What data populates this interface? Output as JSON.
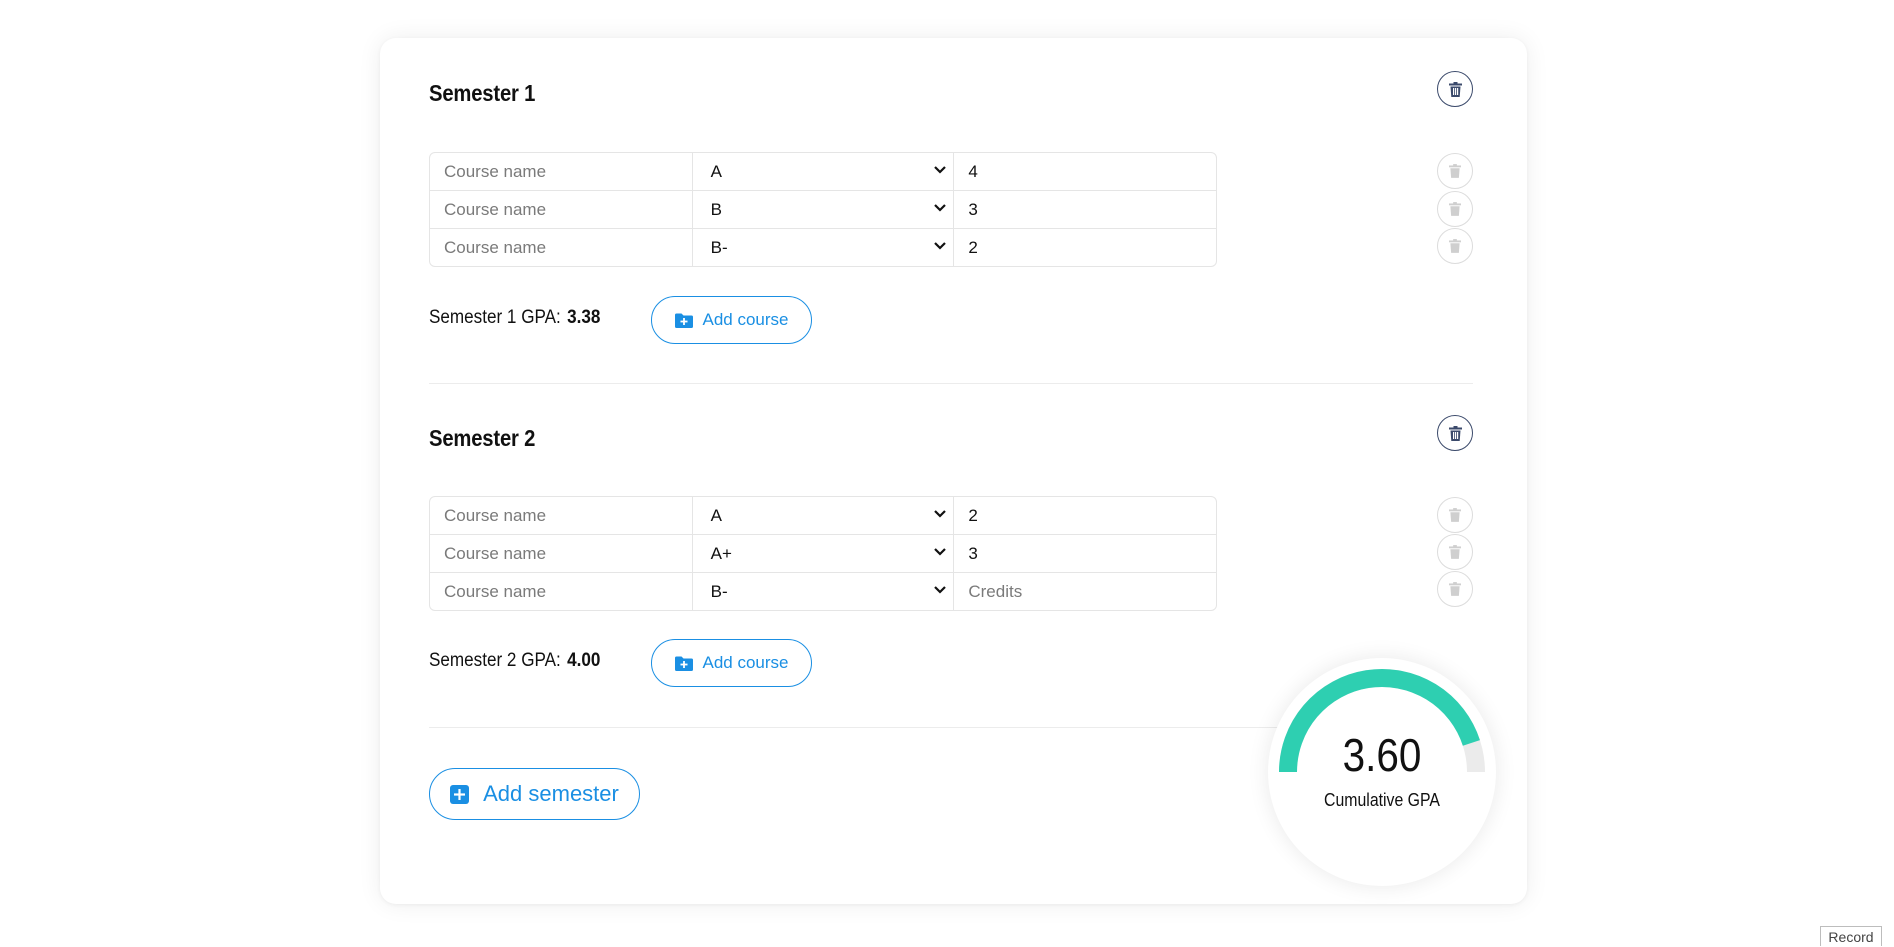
{
  "semesters": [
    {
      "title": "Semester 1",
      "gpa_label": "Semester 1 GPA:",
      "gpa_value": "3.38",
      "add_course_label": "Add course",
      "courses": [
        {
          "name": "",
          "grade": "A",
          "credits": "4"
        },
        {
          "name": "",
          "grade": "B",
          "credits": "3"
        },
        {
          "name": "",
          "grade": "B-",
          "credits": "2"
        }
      ]
    },
    {
      "title": "Semester 2",
      "gpa_label": "Semester 2 GPA:",
      "gpa_value": "4.00",
      "add_course_label": "Add course",
      "courses": [
        {
          "name": "",
          "grade": "A",
          "credits": "2"
        },
        {
          "name": "",
          "grade": "A+",
          "credits": "3"
        },
        {
          "name": "",
          "grade": "B-",
          "credits": ""
        }
      ]
    }
  ],
  "placeholders": {
    "course_name": "Course name",
    "credits": "Credits"
  },
  "add_semester_label": "Add semester",
  "cumulative": {
    "value": "3.60",
    "label": "Cumulative GPA",
    "fraction": 0.9
  },
  "record_label": "Record",
  "icons": {
    "delete": "trash-icon",
    "add_course": "folder-plus-icon",
    "add_semester": "plus-square-icon",
    "dropdown": "chevron-down-icon"
  },
  "colors": {
    "accent": "#1a8fe3",
    "gauge_fill": "#2ecfb1",
    "gauge_track": "#ebebeb",
    "delete_active": "#3b4a6b"
  }
}
